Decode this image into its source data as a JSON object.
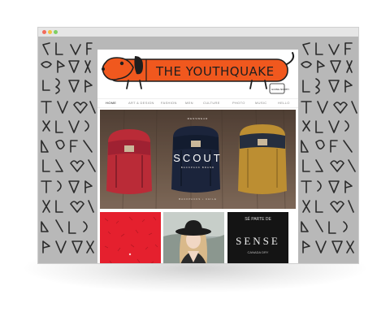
{
  "site": {
    "title": "THE YOUTHQUAKE",
    "badge": "GOING NORTH"
  },
  "nav": {
    "items": [
      "HOME",
      "ART & DESIGN",
      "FASHION",
      "MEN",
      "CULTURE",
      "PHOTO",
      "MUSIC",
      "HELLO"
    ],
    "active": "HOME"
  },
  "hero": {
    "tag": "MENSWEAR",
    "title": "SCOUT",
    "subtitle": "BACKPACK BRAND",
    "footer": "BACKPACKS • CHILE"
  },
  "tiles": {
    "third_top": "SÉ PARTE DE",
    "third_mid": "SENSE",
    "third_low": "CANADA DRY"
  },
  "colors": {
    "accent": "#f0581e",
    "pattern_bg": "#b8b8b8",
    "tile_red": "#e5202e"
  }
}
